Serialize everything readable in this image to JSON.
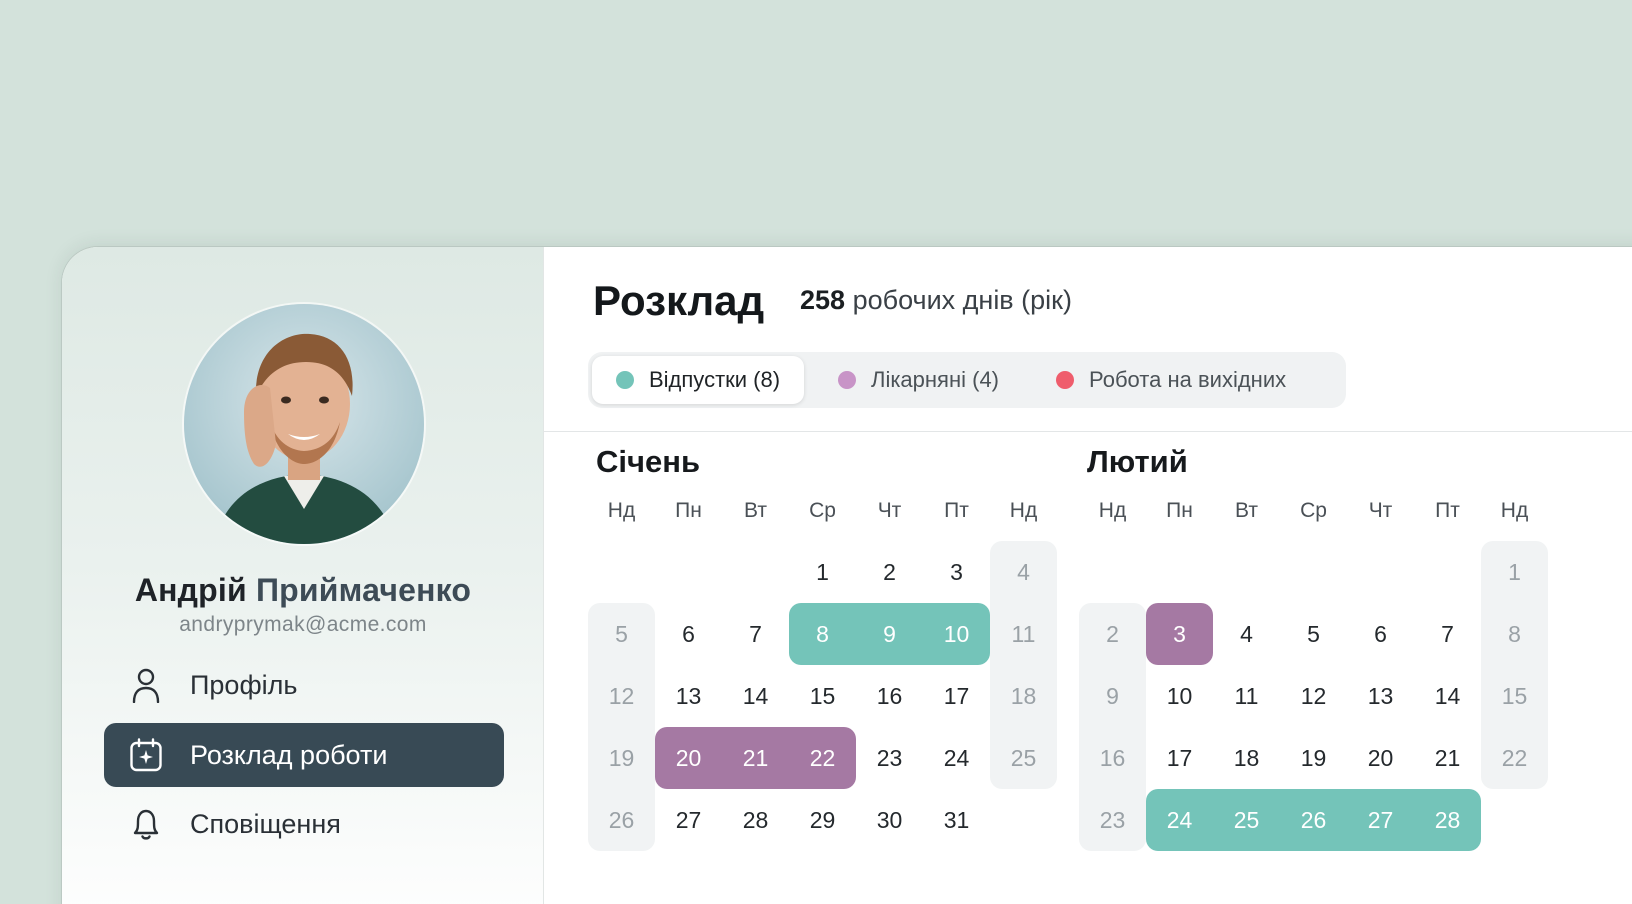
{
  "colors": {
    "vacation": "#74c4b9",
    "sick": "#a579a3",
    "weekend_work": "#ef5d6c",
    "active_nav": "#384a55"
  },
  "user": {
    "first_name": "Андрій",
    "last_name": "Приймаченко",
    "email": "andryprymak@acme.com"
  },
  "nav": [
    {
      "label": "Профіль",
      "icon": "user-icon",
      "active": false
    },
    {
      "label": "Розклад роботи",
      "icon": "calendar-star-icon",
      "active": true
    },
    {
      "label": "Сповіщення",
      "icon": "bell-icon",
      "active": false
    }
  ],
  "header": {
    "title": "Розклад",
    "work_days_count": "258",
    "work_days_label": "робочих днів (рік)"
  },
  "tabs": [
    {
      "label": "Відпустки (8)",
      "color": "#74c4b9",
      "active": true
    },
    {
      "label": "Лікарняні (4)",
      "color": "#c894c7",
      "active": false
    },
    {
      "label": "Робота на вихідних",
      "color": "#ef5d6c",
      "active": false
    }
  ],
  "weekday_labels": [
    "Нд",
    "Пн",
    "Вт",
    "Ср",
    "Чт",
    "Пт",
    "Нд"
  ],
  "months": [
    {
      "name": "Січень",
      "weeks": [
        [
          "",
          "",
          "",
          "1",
          "2",
          "3",
          "4"
        ],
        [
          "5",
          "6",
          "7",
          "8",
          "9",
          "10",
          "11"
        ],
        [
          "12",
          "13",
          "14",
          "15",
          "16",
          "17",
          "18"
        ],
        [
          "19",
          "20",
          "21",
          "22",
          "23",
          "24",
          "25"
        ],
        [
          "26",
          "27",
          "28",
          "29",
          "30",
          "31",
          ""
        ]
      ],
      "vacation_days": [
        "8",
        "9",
        "10"
      ],
      "sick_days": [
        "20",
        "21",
        "22"
      ]
    },
    {
      "name": "Лютий",
      "weeks": [
        [
          "",
          "",
          "",
          "",
          "",
          "",
          "1"
        ],
        [
          "2",
          "3",
          "4",
          "5",
          "6",
          "7",
          "8"
        ],
        [
          "9",
          "10",
          "11",
          "12",
          "13",
          "14",
          "15"
        ],
        [
          "16",
          "17",
          "18",
          "19",
          "20",
          "21",
          "22"
        ],
        [
          "23",
          "24",
          "25",
          "26",
          "27",
          "28",
          ""
        ]
      ],
      "vacation_days": [
        "24",
        "25",
        "26",
        "27",
        "28"
      ],
      "sick_days": [
        "3"
      ]
    }
  ]
}
